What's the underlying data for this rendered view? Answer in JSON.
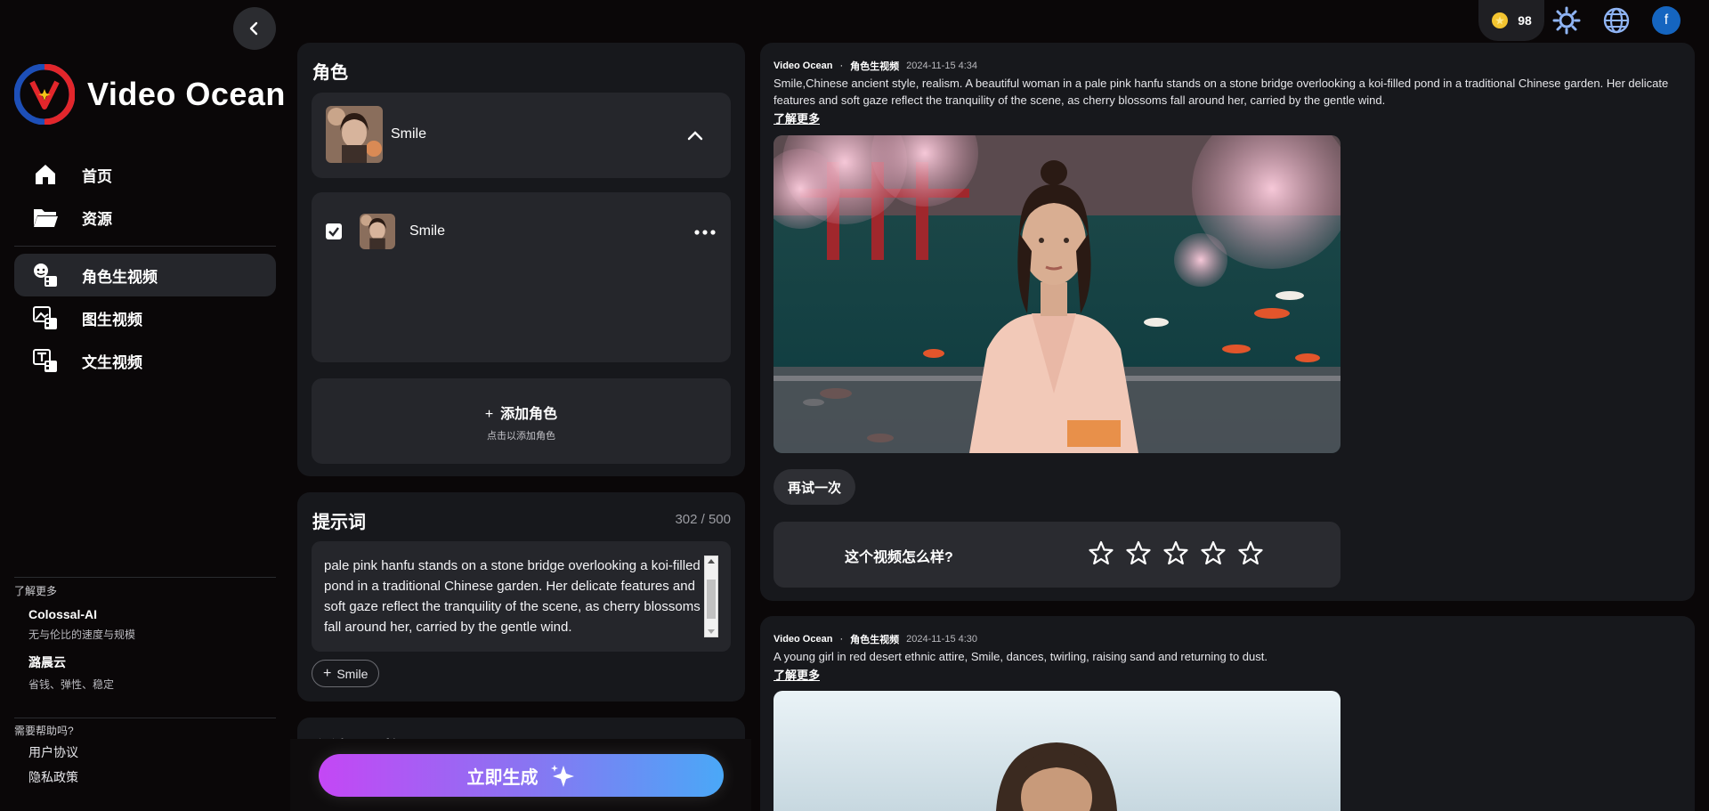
{
  "sidebar": {
    "brand": "Video Ocean",
    "nav": [
      {
        "label": "首页",
        "icon": "home-icon"
      },
      {
        "label": "资源",
        "icon": "folder-icon"
      }
    ],
    "tools": [
      {
        "label": "角色生视频",
        "icon": "character-video-icon",
        "active": true
      },
      {
        "label": "图生视频",
        "icon": "image-video-icon",
        "active": false
      },
      {
        "label": "文生视频",
        "icon": "text-video-icon",
        "active": false
      }
    ],
    "learn_more_title": "了解更多",
    "partners": [
      {
        "name": "Colossal-AI",
        "tagline": "无与伦比的速度与规模"
      },
      {
        "name": "潞晨云",
        "tagline": "省钱、弹性、稳定"
      }
    ],
    "help_title": "需要帮助吗?",
    "help_links": [
      "用户协议",
      "隐私政策"
    ]
  },
  "character_panel": {
    "title": "角色",
    "selected": "Smile",
    "list": [
      {
        "name": "Smile",
        "checked": true
      }
    ],
    "add_label": "添加角色",
    "add_hint": "点击以添加角色"
  },
  "prompt_panel": {
    "title": "提示词",
    "counter": "302 / 500",
    "text": "pale pink hanfu stands on a stone bridge overlooking a koi-filled pond in a traditional Chinese garden. Her delicate features and soft gaze reflect the tranquility of the scene, as cherry blossoms fall around her, carried by the gentle wind.",
    "tag": "Smile",
    "next_section_partial": "主镜与风格"
  },
  "generate_label": "立即生成",
  "topbar": {
    "credits": "98",
    "avatar_letter": "f"
  },
  "feed": [
    {
      "source": "Video Ocean",
      "mode": "角色生视频",
      "date": "2024-11-15 4:34",
      "description": "Smile,Chinese ancient style, realism. A beautiful woman in a pale pink hanfu stands on a stone bridge overlooking a koi-filled pond in a traditional Chinese garden. Her delicate features and soft gaze reflect the tranquility of the scene, as cherry blossoms fall around her, carried by the gentle wind.",
      "more": "了解更多",
      "retry": "再试一次",
      "rating_question": "这个视频怎么样?",
      "stars": 5
    },
    {
      "source": "Video Ocean",
      "mode": "角色生视频",
      "date": "2024-11-15 4:30",
      "description": "A young girl in red desert ethnic attire, Smile, dances, twirling, raising sand and returning to dust.",
      "more": "了解更多"
    }
  ],
  "colors": {
    "accent_start": "#c447f5",
    "accent_end": "#4aa8f7",
    "panel": "#17181c",
    "inner": "#25262b"
  }
}
